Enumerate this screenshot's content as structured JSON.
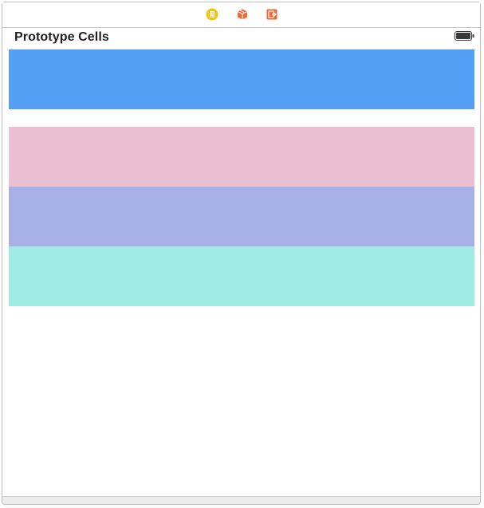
{
  "scene": {
    "title": "Prototype Cells"
  },
  "dock": {
    "icons": [
      "view-controller-icon",
      "first-responder-icon",
      "exit-icon"
    ]
  },
  "status_bar": {
    "battery_icon": "battery-icon"
  },
  "cells": [
    {
      "name": "cell-1",
      "color": "#529ff5"
    },
    {
      "name": "cell-2",
      "color": "#ebbed2"
    },
    {
      "name": "cell-3",
      "color": "#a7b1e8"
    },
    {
      "name": "cell-4",
      "color": "#a1ebe5"
    }
  ],
  "colors": {
    "view_controller": "#f5c20f",
    "first_responder": "#ec6a3a",
    "exit": "#ec6a3a"
  }
}
